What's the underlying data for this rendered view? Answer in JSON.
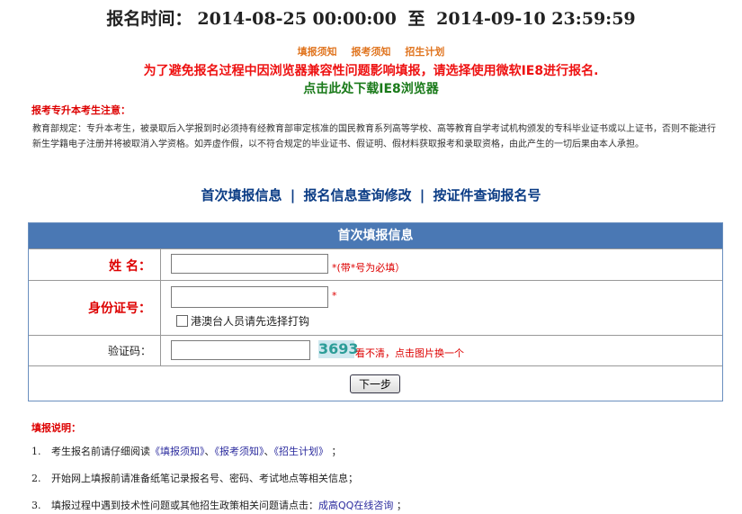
{
  "header": {
    "time_label": "报名时间：",
    "time_start": "2014-08-25 00:00:00",
    "time_to": "至",
    "time_end": "2014-09-10 23:59:59"
  },
  "top_links": [
    "填报须知",
    "报考须知",
    "招生计划"
  ],
  "warning_text": "为了避免报名过程中因浏览器兼容性问题影响填报，请选择使用微软IE8进行报名.",
  "download_text": "点击此处下载IE8浏览器",
  "notice": {
    "title": "报考专升本考生注意：",
    "body": "教育部规定：专升本考生，被录取后入学报到时必须持有经教育部审定核准的国民教育系列高等学校、高等教育自学考试机构颁发的专科毕业证书或以上证书，否则不能进行新生学籍电子注册并将被取消入学资格。如弄虚作假，以不符合规定的毕业证书、假证明、假材料获取报考和录取资格，由此产生的一切后果由本人承担。"
  },
  "nav_tabs": [
    "首次填报信息",
    "报名信息查询修改",
    "按证件查询报名号"
  ],
  "nav_sep": "|",
  "form": {
    "header": "首次填报信息",
    "name_label": "姓  名：",
    "name_value": "",
    "name_hint": "*(带*号为必填）",
    "id_label": "身份证号：",
    "id_value": "",
    "id_hint": "*",
    "hk_checkbox_label": "港澳台人员请先选择打钩",
    "captcha_label": "验证码：",
    "captcha_value": "",
    "captcha_code": "3693",
    "captcha_hint": "看不清，点击图片换一个",
    "next_button": "下一步"
  },
  "fill_instructions": {
    "title": "填报说明：",
    "items": [
      {
        "num": "1.",
        "text": "考生报名前请仔细阅读",
        "links": [
          "《填报须知》",
          "《报考须知》",
          "《招生计划》"
        ],
        "sep": "、",
        "tail": " ；"
      },
      {
        "num": "2.",
        "text": "开始网上填报前请准备纸笔记录报名号、密码、考试地点等相关信息；"
      },
      {
        "num": "3.",
        "text": "填报过程中遇到技术性问题或其他招生政策相关问题请点击：",
        "link": "成高QQ在线咨询",
        "tail": " ；"
      }
    ]
  }
}
